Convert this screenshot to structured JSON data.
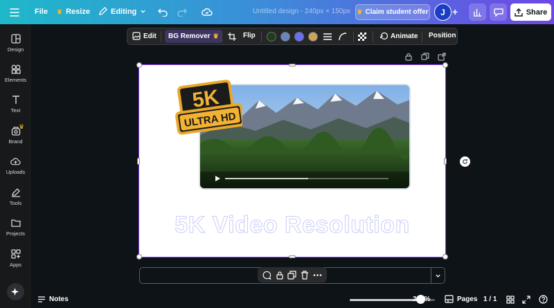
{
  "header": {
    "file_label": "File",
    "resize_label": "Resize",
    "editing_label": "Editing",
    "doc_title": "Untitled design - 240px × 150px",
    "claim_label": "Claim student offer",
    "avatar_initial": "J",
    "share_label": "Share"
  },
  "sidebar": {
    "items": [
      {
        "label": "Design",
        "icon": "layout-icon"
      },
      {
        "label": "Elements",
        "icon": "shapes-icon"
      },
      {
        "label": "Text",
        "icon": "text-icon"
      },
      {
        "label": "Brand",
        "icon": "brand-icon"
      },
      {
        "label": "Uploads",
        "icon": "cloud-upload-icon"
      },
      {
        "label": "Tools",
        "icon": "pen-icon"
      },
      {
        "label": "Projects",
        "icon": "folder-icon"
      },
      {
        "label": "Apps",
        "icon": "apps-icon"
      }
    ]
  },
  "toolbar": {
    "edit_label": "Edit",
    "bg_remover_label": "BG Remover",
    "flip_label": "Flip",
    "swatches": [
      "#1e3d1a",
      "#6b86b8",
      "#6a6ef2",
      "#c9a55c"
    ],
    "animate_label": "Animate",
    "position_label": "Position"
  },
  "canvas": {
    "badge_top": "5K",
    "badge_bottom": "ULTRA HD",
    "headline": "5K Video Resolution"
  },
  "footer": {
    "notes_label": "Notes",
    "zoom_label": "299%",
    "zoom_fraction": 0.83,
    "pages_label": "Pages",
    "page_count": "1 / 1"
  },
  "colors": {
    "accent": "#8b3dff",
    "crown": "#f5b92b"
  }
}
